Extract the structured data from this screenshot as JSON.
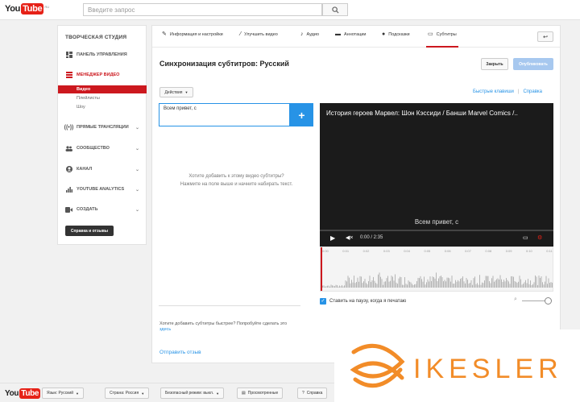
{
  "header": {
    "logo_you": "You",
    "logo_tube": "Tube",
    "logo_region": "RU",
    "search_placeholder": "Введите запрос",
    "search_icon": "search-icon"
  },
  "sidebar": {
    "title": "ТВОРЧЕСКАЯ СТУДИЯ",
    "items": [
      {
        "label": "ПАНЕЛЬ УПРАВЛЕНИЯ",
        "icon": "dashboard-icon"
      },
      {
        "label": "МЕНЕДЖЕР ВИДЕО",
        "icon": "video-manager-icon"
      },
      {
        "label": "ПРЯМЫЕ ТРАНСЛЯЦИИ",
        "icon": "live-icon"
      },
      {
        "label": "СООБЩЕСТВО",
        "icon": "community-icon"
      },
      {
        "label": "КАНАЛ",
        "icon": "channel-icon"
      },
      {
        "label": "YOUTUBE ANALYTICS",
        "icon": "analytics-icon"
      },
      {
        "label": "СОЗДАТЬ",
        "icon": "create-icon"
      }
    ],
    "sub_items": [
      "Видео",
      "Плейлисты",
      "Шоу"
    ],
    "help_button": "Справка и отзывы"
  },
  "tabs": [
    {
      "label": "Информация и настройки",
      "icon": "pencil-icon"
    },
    {
      "label": "Улучшить видео",
      "icon": "magic-wand-icon"
    },
    {
      "label": "Аудио",
      "icon": "music-icon"
    },
    {
      "label": "Аннотации",
      "icon": "annotation-icon"
    },
    {
      "label": "Подсказки",
      "icon": "info-icon"
    },
    {
      "label": "Субтитры",
      "icon": "subtitles-icon"
    }
  ],
  "page": {
    "title": "Синхронизация субтитров: Русский",
    "close_button": "Закрыть",
    "publish_button": "Опубликовать",
    "actions_button": "Действия",
    "hotkeys_link": "Быстрые клавиши",
    "help_link": "Справка",
    "caption_input_value": "Всем привет, с",
    "empty_line1": "Хотите добавить к этому видео субтитры?",
    "empty_line2": "Нажмите на поле выше и начните набирать текст.",
    "faster_text": "Хотите добавить субтитры быстрее? Попробуйте сделать это",
    "faster_link": "здесь",
    "feedback_link": "Отправить отзыв"
  },
  "video": {
    "title": "История героев Марвел: Шон Кэссиди / Банши Marvel Comics /..",
    "caption_overlay": "Всем привет, с",
    "time": "0:00 / 2:35",
    "progress": 0
  },
  "waveform": {
    "ticks": [
      "0:00",
      "0:01",
      "0:02",
      "0:03",
      "0:04",
      "0:05",
      "0:06",
      "0:07",
      "0:08",
      "0:09",
      "0:10",
      "0:11"
    ]
  },
  "pause_option": "Ставить на паузу, когда я печатаю",
  "footer": {
    "language": "Язык: Русский",
    "country": "Страна: Россия",
    "safe_mode": "Безопасный режим: выкл.",
    "history": "Просмотренные",
    "help": "Справка"
  },
  "watermark": {
    "text": "IKESLER"
  },
  "colors": {
    "accent_red": "#cc181e",
    "accent_blue": "#2793e6",
    "watermark_orange": "#f28c28"
  }
}
